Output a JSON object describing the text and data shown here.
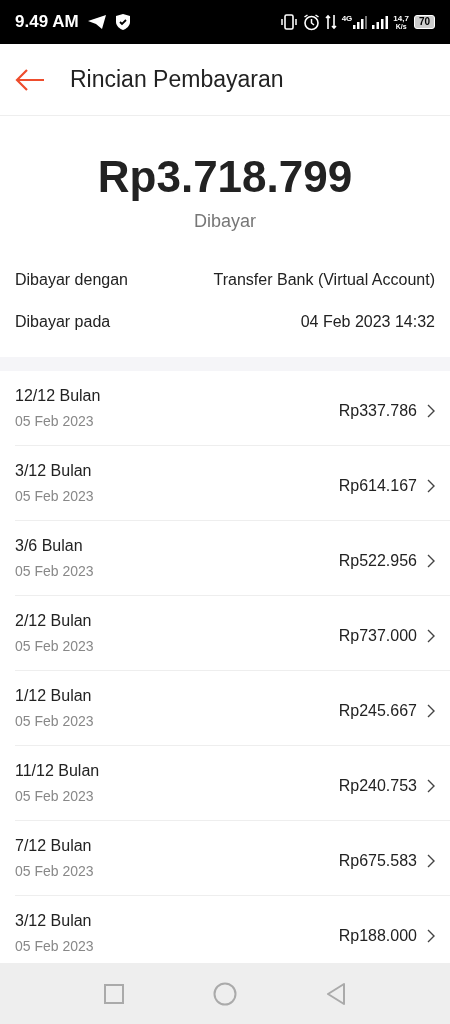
{
  "status_bar": {
    "time": "9.49 AM",
    "network": "4G",
    "speed": "14,7",
    "speed_unit": "K/s",
    "battery": "70"
  },
  "header": {
    "title": "Rincian Pembayaran"
  },
  "summary": {
    "amount": "Rp3.718.799",
    "status": "Dibayar"
  },
  "details": [
    {
      "label": "Dibayar dengan",
      "value": "Transfer Bank (Virtual Account)"
    },
    {
      "label": "Dibayar pada",
      "value": "04 Feb 2023 14:32"
    }
  ],
  "installments": [
    {
      "term": "12/12 Bulan",
      "date": "05 Feb 2023",
      "amount": "Rp337.786"
    },
    {
      "term": "3/12 Bulan",
      "date": "05 Feb 2023",
      "amount": "Rp614.167"
    },
    {
      "term": "3/6 Bulan",
      "date": "05 Feb 2023",
      "amount": "Rp522.956"
    },
    {
      "term": "2/12 Bulan",
      "date": "05 Feb 2023",
      "amount": "Rp737.000"
    },
    {
      "term": "1/12 Bulan",
      "date": "05 Feb 2023",
      "amount": "Rp245.667"
    },
    {
      "term": "11/12 Bulan",
      "date": "05 Feb 2023",
      "amount": "Rp240.753"
    },
    {
      "term": "7/12 Bulan",
      "date": "05 Feb 2023",
      "amount": "Rp675.583"
    },
    {
      "term": "3/12 Bulan",
      "date": "05 Feb 2023",
      "amount": "Rp188.000"
    }
  ]
}
